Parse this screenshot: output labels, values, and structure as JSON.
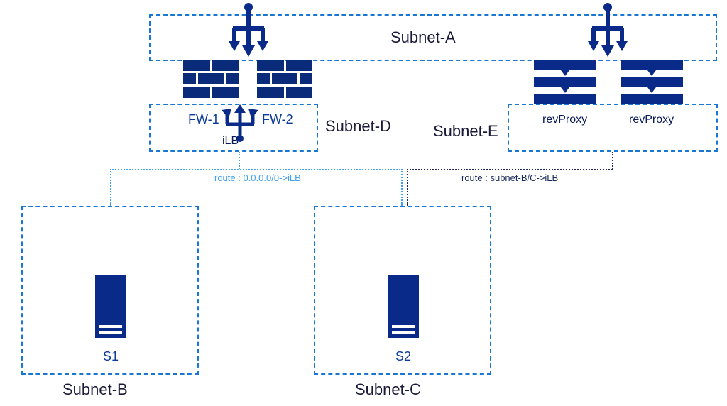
{
  "subnets": {
    "a": {
      "label": "Subnet-A"
    },
    "b": {
      "label": "Subnet-B"
    },
    "c": {
      "label": "Subnet-C"
    },
    "d": {
      "label": "Subnet-D"
    },
    "e": {
      "label": "Subnet-E"
    }
  },
  "firewalls": {
    "fw1": {
      "label": "FW-1"
    },
    "fw2": {
      "label": "FW-2"
    }
  },
  "ilb": {
    "label": "iLB"
  },
  "revproxy": {
    "left": {
      "label": "revProxy"
    },
    "right": {
      "label": "revProxy"
    }
  },
  "servers": {
    "s1": {
      "label": "S1"
    },
    "s2": {
      "label": "S2"
    }
  },
  "routes": {
    "light": {
      "label": "route : 0.0.0.0/0->iLB"
    },
    "dark": {
      "label": "route : subnet-B/C->iLB"
    }
  },
  "colors": {
    "border": "#1976d2",
    "fill": "#0a2a8a",
    "routeLight": "#3da0f0",
    "routeDark": "#1a2a5a"
  }
}
